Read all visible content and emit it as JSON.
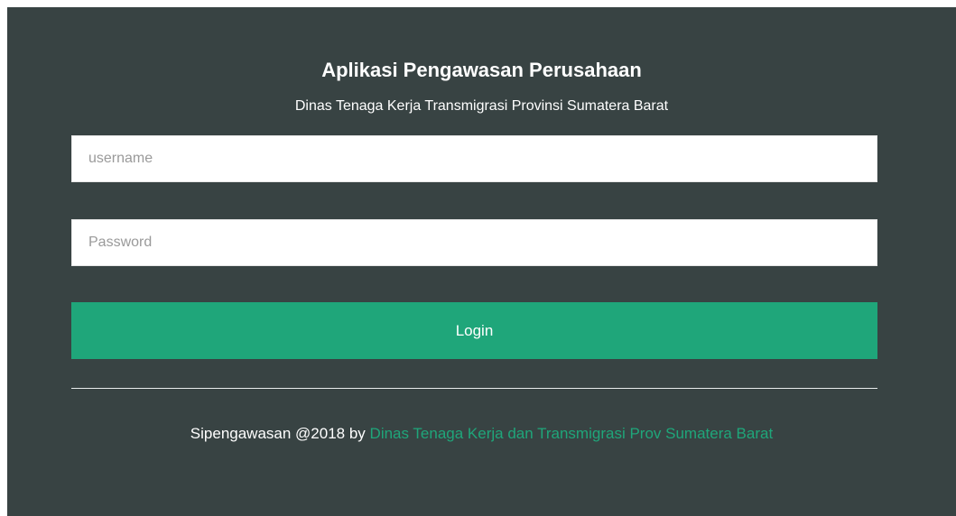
{
  "header": {
    "title": "Aplikasi Pengawasan Perusahaan",
    "subtitle": "Dinas Tenaga Kerja Transmigrasi Provinsi Sumatera Barat"
  },
  "form": {
    "username_placeholder": "username",
    "username_value": "",
    "password_placeholder": "Password",
    "password_value": "",
    "login_label": "Login"
  },
  "footer": {
    "text": "Sipengawasan @2018 by",
    "link_text": "Dinas Tenaga Kerja dan Transmigrasi Prov Sumatera Barat"
  },
  "colors": {
    "panel_background": "#384343",
    "accent": "#1fa67a",
    "text_light": "#ffffff"
  }
}
